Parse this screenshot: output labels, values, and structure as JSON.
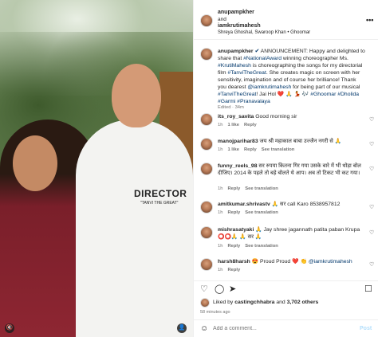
{
  "photo": {
    "shirt_text": "DIRECTOR",
    "shirt_subtext": "\"TANVI THE GREAT\""
  },
  "header": {
    "user1": "anupampkher",
    "and": "and",
    "user2": "iamkrutimahesh",
    "music": "Shreya Ghoshal, Swaroop Khan • Ghoomar",
    "more": "•••"
  },
  "caption": {
    "user": "anupampkher",
    "verified": "✔",
    "text_1": " ANNOUNCEMENT: Happy and delighted to share that ",
    "tag_1": "#NationalAward",
    "text_2": " winning choreographer Ms. ",
    "tag_2": "#KrutiMahesh",
    "text_3": " is choreographing the songs for my directorial film ",
    "tag_3": "#TanviTheGreat",
    "text_4": ". She creates magic on screen with her sensitivity, imagination and of course her brilliance! Thank you dearest ",
    "tag_4": "@iamkrutimahesh",
    "text_5": " for being part of our musical ",
    "tag_5": "#TanviTheGreat",
    "text_6": "! Jai Hol ❤️ 🙏 💃 🎶 ",
    "tag_6": "#Ghoomar #Dholida #Garmi #Pranavalaya",
    "meta": "Edited · 34m"
  },
  "comments": [
    {
      "user": "its_roy_savita",
      "text": " Good morning sir",
      "meta": [
        "1h",
        "1 like",
        "Reply"
      ]
    },
    {
      "user": "manojparihar83",
      "text": " जय श्री महाकाल बाबा उज्जैन नगरी से 🙏",
      "meta": [
        "1h",
        "1 like",
        "Reply",
        "See translation"
      ]
    },
    {
      "user": "funny_reels_98",
      "text": " सर रुपया कितना गिर गया उसके बारे में भी थोड़ा बोल दीजिए। 2014 के पहले तो बड़े बोलते थे आप। अब तो टिकट भी कट गया।",
      "meta": [
        "1h",
        "Reply",
        "See translation"
      ]
    },
    {
      "user": "amitkumar.shrivastv",
      "text": " 🙏 सर call Karo 8538957812",
      "meta": [
        "1h",
        "Reply",
        "See translation"
      ]
    },
    {
      "user": "mishrasatyaki",
      "text": " 🙏 Jay shree jagannath patita paban Krupa ⭕⭕🙏 🙏 सर 🙏",
      "meta": [
        "1h",
        "Reply",
        "See translation"
      ]
    },
    {
      "user": "harsh8harsh",
      "text": " 😍 Proud Proud ❤️ 👏 ",
      "tag": "@iamkrutimahesh",
      "meta": [
        "1h",
        "Reply"
      ]
    }
  ],
  "likes": {
    "prefix": "Liked by ",
    "user": "castingchhabra",
    "mid": " and ",
    "count": "3,702 others"
  },
  "time": "58 minutes ago",
  "add_comment": {
    "placeholder": "Add a comment...",
    "post": "Post"
  }
}
